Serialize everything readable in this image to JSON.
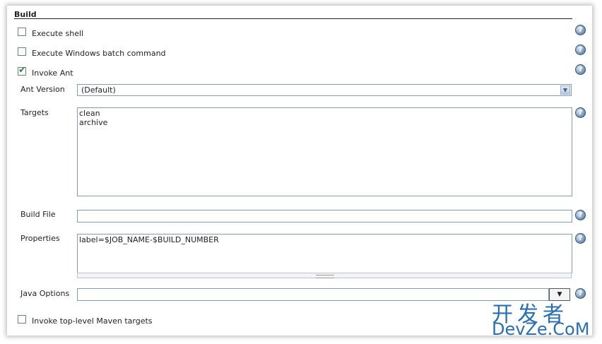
{
  "section": {
    "title": "Build"
  },
  "options": {
    "execute_shell": {
      "label": "Execute shell",
      "checked": false
    },
    "execute_windows": {
      "label": "Execute Windows batch command",
      "checked": false
    },
    "invoke_ant": {
      "label": "Invoke Ant",
      "checked": true
    },
    "invoke_maven": {
      "label": "Invoke top-level Maven targets",
      "checked": false
    }
  },
  "ant": {
    "version_label": "Ant Version",
    "version_value": "(Default)",
    "targets_label": "Targets",
    "targets_line1": "clean",
    "targets_line2": "archive",
    "build_file_label": "Build File",
    "build_file_value": "",
    "properties_label": "Properties",
    "properties_value": "label=$JOB_NAME-$BUILD_NUMBER",
    "java_options_label": "Java Options",
    "java_options_value": ""
  },
  "icons": {
    "help": "?",
    "dropdown_arrow": "▼",
    "checkmark": "✔"
  },
  "watermark": {
    "line1": "开发者",
    "line2": "DevZe.CoM"
  }
}
